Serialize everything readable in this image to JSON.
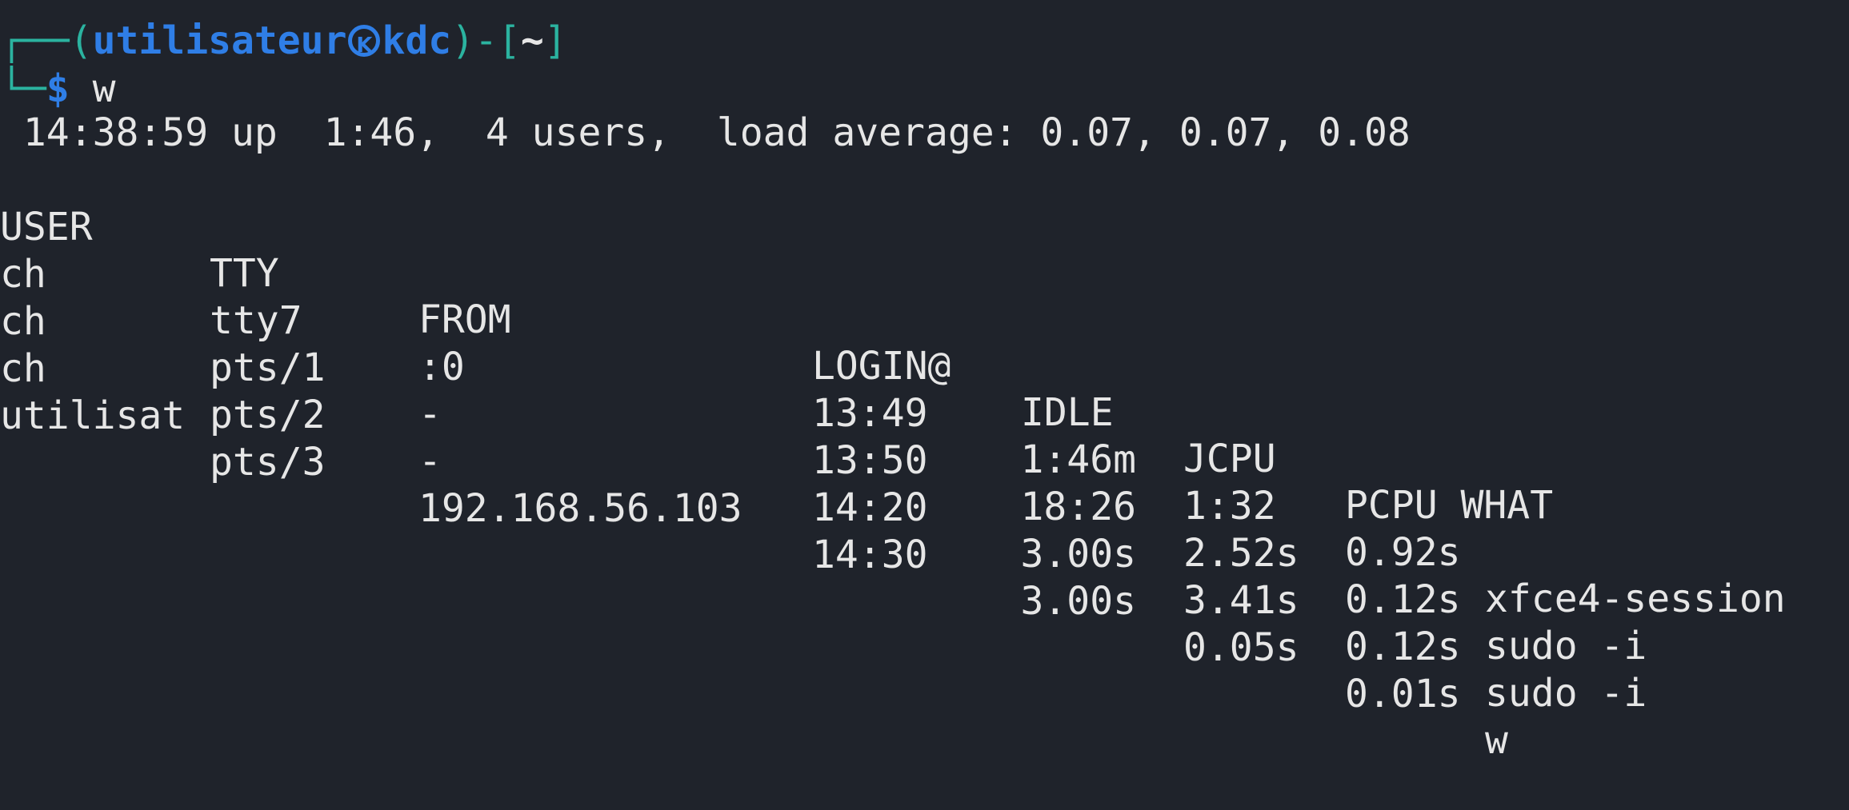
{
  "prompt": {
    "open": "┌──(",
    "user": "utilisateur",
    "host_icon": "kali-dragon-icon",
    "host": "kdc",
    "mid": ")-[",
    "cwd": "~",
    "close": "]",
    "corner": "└─",
    "dollar": "$",
    "command": "w"
  },
  "uptime": " 14:38:59 up  1:46,  4 users,  load average: 0.07, 0.07, 0.08",
  "table": {
    "headers": {
      "user": "USER",
      "tty": "TTY",
      "from": "FROM",
      "login": "LOGIN@",
      "idle": "IDLE",
      "jcpu": "JCPU",
      "pcpu_what": "PCPU WHAT"
    },
    "rows": [
      {
        "user": "ch",
        "tty": "tty7",
        "from": ":0",
        "login": "13:49",
        "idle": "1:46m",
        "jcpu": "1:32",
        "pcpu": "0.92s",
        "what": "xfce4-session"
      },
      {
        "user": "ch",
        "tty": "pts/1",
        "from": "-",
        "login": "13:50",
        "idle": "18:26",
        "jcpu": "2.52s",
        "pcpu": "0.12s",
        "what": "sudo -i"
      },
      {
        "user": "ch",
        "tty": "pts/2",
        "from": "-",
        "login": "14:20",
        "idle": "3.00s",
        "jcpu": "3.41s",
        "pcpu": "0.12s",
        "what": "sudo -i"
      },
      {
        "user": "utilisat",
        "tty": "pts/3",
        "from": "192.168.56.103",
        "login": "14:30",
        "idle": "3.00s",
        "jcpu": "0.05s",
        "pcpu": "0.01s",
        "what": "w"
      }
    ]
  },
  "colors": {
    "background": "#1f232b",
    "prompt_box": "#2bb3a0",
    "prompt_user": "#2f7ee6",
    "text": "#e6e6e6"
  }
}
